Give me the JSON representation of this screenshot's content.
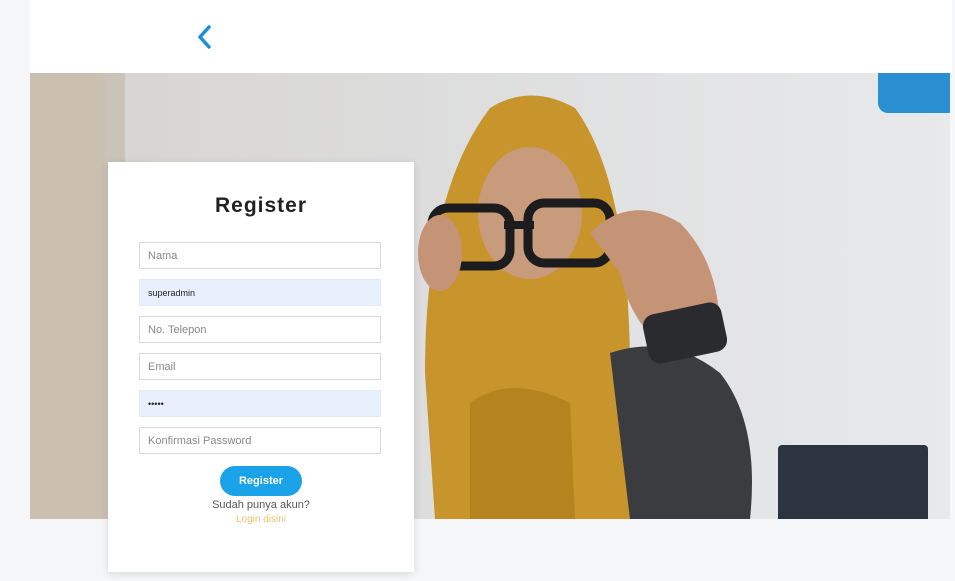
{
  "nav": {
    "back_icon": "chevron-left-icon"
  },
  "register_form": {
    "title": "Register",
    "fields": [
      {
        "placeholder": "Nama",
        "value": ""
      },
      {
        "placeholder": "",
        "value": "superadmin"
      },
      {
        "placeholder": "No. Telepon",
        "value": ""
      },
      {
        "placeholder": "Email",
        "value": ""
      },
      {
        "placeholder": "",
        "value": "•••••"
      },
      {
        "placeholder": "Konfirmasi Password",
        "value": ""
      }
    ],
    "submit_label": "Register",
    "have_account_text": "Sudah punya akun?",
    "login_link": "Login disini"
  },
  "colors": {
    "accent": "#1aa3e8",
    "link": "#f1c26b",
    "autofill_bg": "#e8effd"
  }
}
